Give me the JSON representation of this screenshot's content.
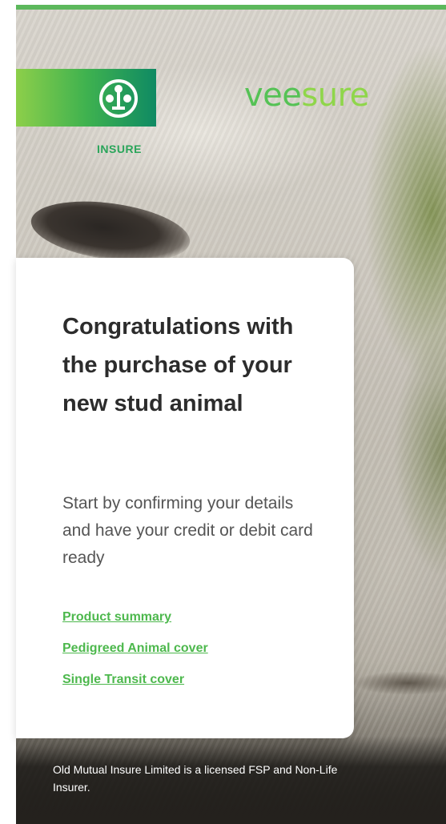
{
  "brand": {
    "partner_logo_label": "INSURE",
    "name_part1": "vee",
    "name_part2": "sure"
  },
  "card": {
    "title": "Congratulations with the purchase of your new stud animal",
    "description": "Start by confirming your details and have your credit or debit card ready",
    "links": [
      {
        "label": "Product summary"
      },
      {
        "label": "Pedigreed Animal cover"
      },
      {
        "label": "Single Transit cover"
      }
    ]
  },
  "footer": {
    "disclaimer": "Old Mutual Insure Limited is a licensed FSP and Non-Life Insurer."
  },
  "colors": {
    "accent_green": "#4db84d",
    "logo_gradient_start": "#8dcf4a",
    "logo_gradient_end": "#0f8a63"
  }
}
